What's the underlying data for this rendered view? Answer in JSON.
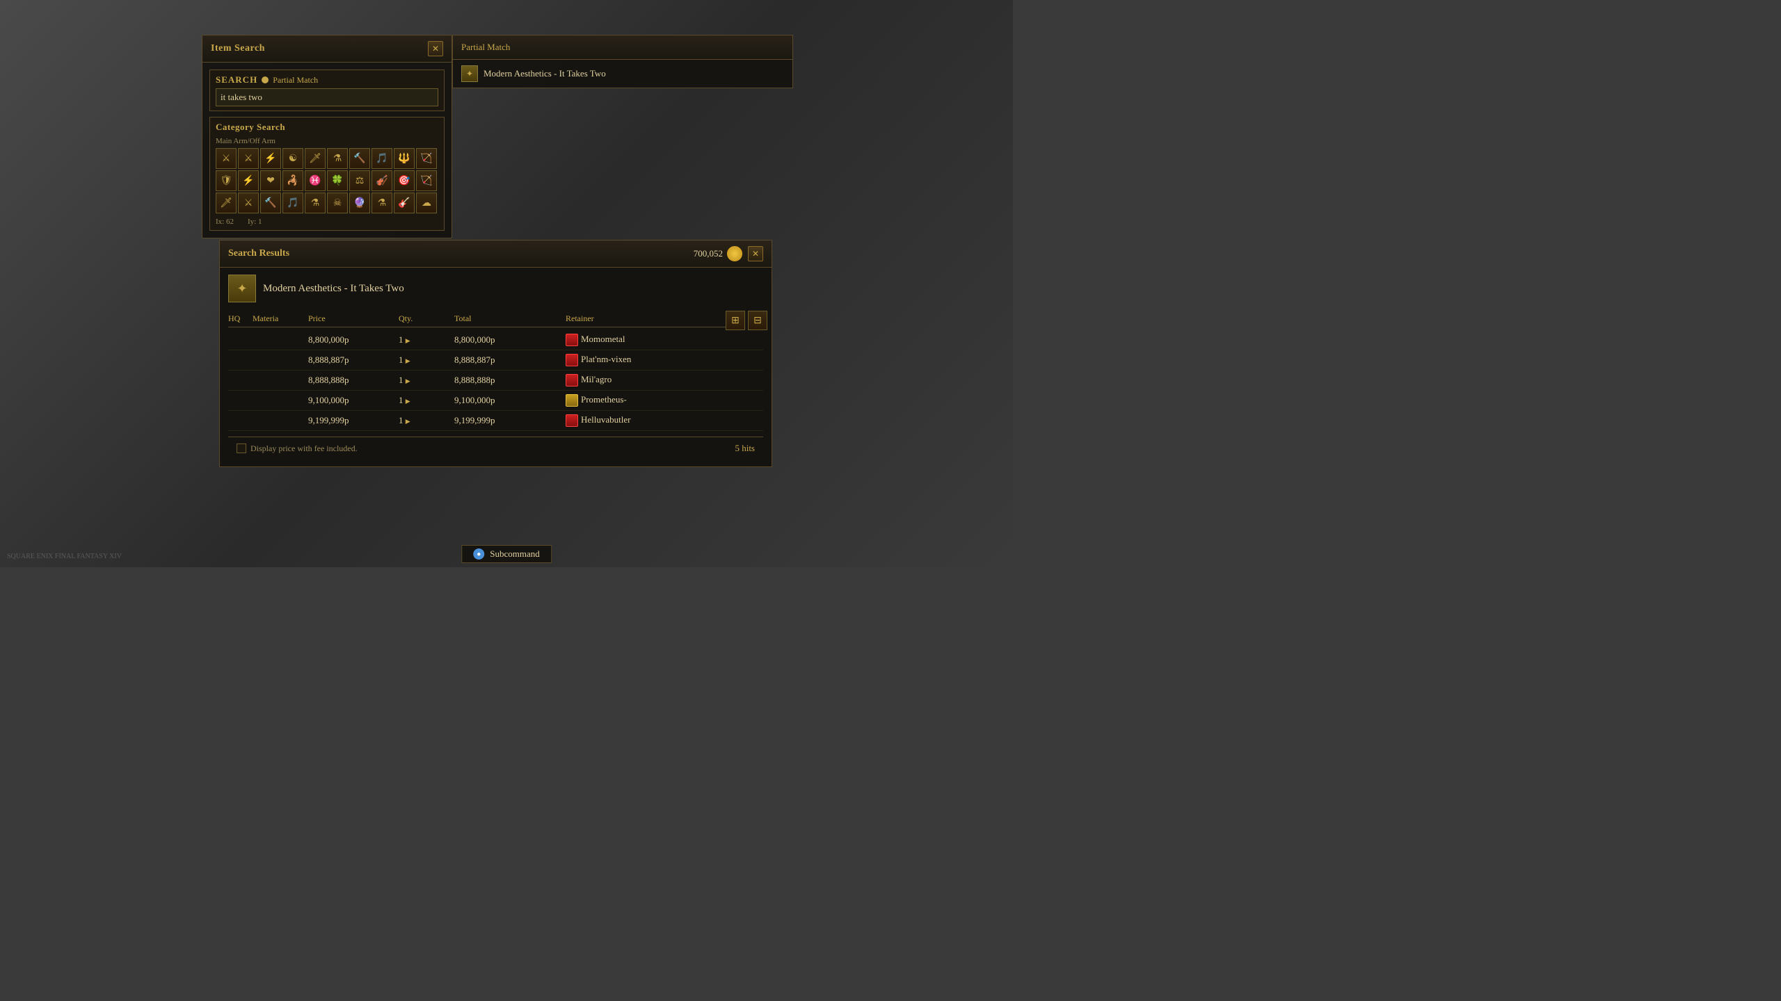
{
  "app": {
    "title": "Item Search",
    "watermark": "SQUARE ENIX  FINAL FANTASY XIV"
  },
  "search_panel": {
    "title": "Item Search",
    "search_label": "Search",
    "partial_match_label": "Partial Match",
    "search_value": "it takes two",
    "search_placeholder": "it takes two",
    "category_label": "Category Search",
    "category_sublabel": "Main Arm/Off Arm",
    "count_ix": "Ix: 62",
    "count_iy": "Iy: 1"
  },
  "partial_match_panel": {
    "title": "Partial Match",
    "result_item": "Modern Aesthetics - It Takes Two"
  },
  "search_results": {
    "title": "Search Results",
    "currency": "700,052",
    "item_name": "Modern Aesthetics - It Takes Two",
    "columns": {
      "hq": "HQ",
      "materia": "Materia",
      "price": "Price",
      "qty": "Qty.",
      "total": "Total",
      "retainer": "Retainer"
    },
    "rows": [
      {
        "hq": "",
        "materia": "",
        "price": "8,800,000p",
        "qty": "1",
        "total": "8,800,000p",
        "retainer_icon": "red",
        "retainer": "Momometal"
      },
      {
        "hq": "",
        "materia": "",
        "price": "8,888,887p",
        "qty": "1",
        "total": "8,888,887p",
        "retainer_icon": "red",
        "retainer": "Plat'nm-vixen"
      },
      {
        "hq": "",
        "materia": "",
        "price": "8,888,888p",
        "qty": "1",
        "total": "8,888,888p",
        "retainer_icon": "red",
        "retainer": "Mil'agro"
      },
      {
        "hq": "",
        "materia": "",
        "price": "9,100,000p",
        "qty": "1",
        "total": "9,100,000p",
        "retainer_icon": "gold",
        "retainer": "Prometheus-"
      },
      {
        "hq": "",
        "materia": "",
        "price": "9,199,999p",
        "qty": "1",
        "total": "9,199,999p",
        "retainer_icon": "red",
        "retainer": "Helluvabutler"
      }
    ],
    "display_fee_label": "Display price with fee included.",
    "hits": "5 hits"
  },
  "subcommand": {
    "label": "Subcommand"
  },
  "icons": {
    "close": "✕",
    "copy": "⊞",
    "filter": "⊟",
    "play": "▶",
    "item_symbol": "✦",
    "subcommand_symbol": "●"
  },
  "weapon_icons": [
    "⚔",
    "⚔",
    "⚡",
    "☯",
    "🗡",
    "⚗",
    "🔨",
    "🎵",
    "🔱",
    "🏹",
    "🛡",
    "⚡",
    "❤",
    "🦂",
    "♓",
    "🍀",
    "⚖",
    "🎻",
    "🎯",
    "🏹",
    "🗡",
    "⚔",
    "🔨",
    "🎵",
    "⚗",
    "☠",
    "🔮",
    "⚗",
    "🎸",
    "☁"
  ]
}
